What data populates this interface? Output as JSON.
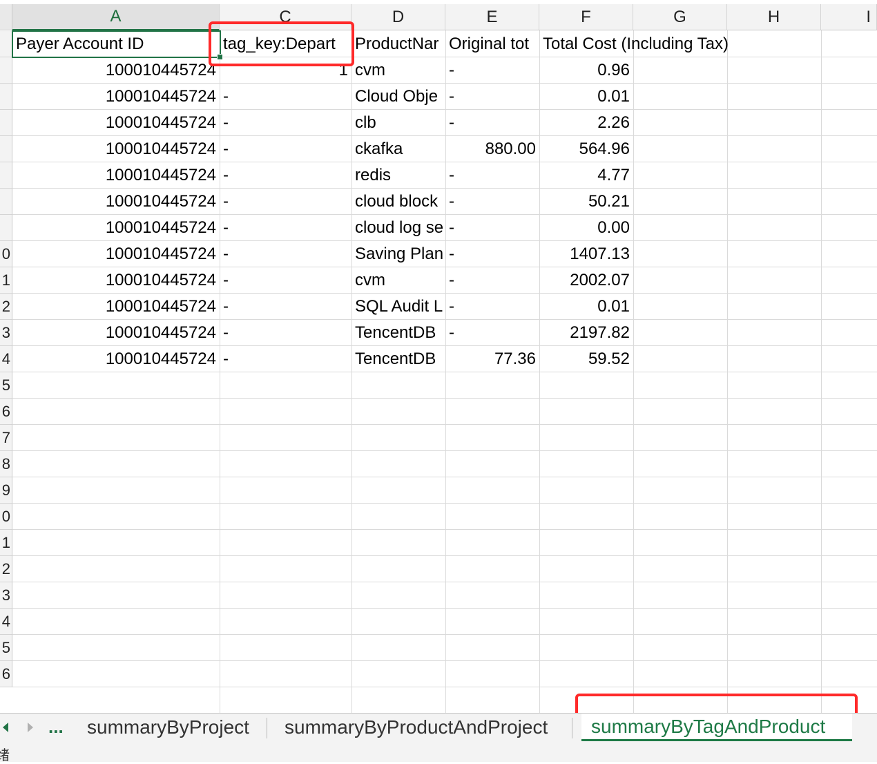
{
  "columns": [
    "A",
    "C",
    "D",
    "E",
    "F",
    "G",
    "H",
    "I"
  ],
  "row_numbers": [
    "",
    "",
    "",
    "",
    "",
    "",
    "",
    "",
    "0",
    "1",
    "2",
    "3",
    "4",
    "5",
    "6",
    "7",
    "8",
    "9",
    "0",
    "1",
    "2",
    "3",
    "4",
    "5",
    "6"
  ],
  "rows": [
    {
      "a": "Payer Account ID",
      "c": "tag_key:Depart",
      "d": "ProductNar",
      "e": "Original tot",
      "f": "Total Cost (Including Tax)"
    },
    {
      "a": "100010445724",
      "c": "1",
      "d": "cvm",
      "e": "-",
      "f": "0.96"
    },
    {
      "a": "100010445724",
      "c": "-",
      "d": "Cloud Obje",
      "e": "-",
      "f": "0.01"
    },
    {
      "a": "100010445724",
      "c": "-",
      "d": "clb",
      "e": "-",
      "f": "2.26"
    },
    {
      "a": "100010445724",
      "c": "-",
      "d": "ckafka",
      "e": "880.00",
      "f": "564.96"
    },
    {
      "a": "100010445724",
      "c": "-",
      "d": "redis",
      "e": "-",
      "f": "4.77"
    },
    {
      "a": "100010445724",
      "c": "-",
      "d": "cloud block",
      "e": "-",
      "f": "50.21"
    },
    {
      "a": "100010445724",
      "c": "-",
      "d": "cloud log se",
      "e": "-",
      "f": "0.00"
    },
    {
      "a": "100010445724",
      "c": "-",
      "d": "Saving Plan",
      "e": "-",
      "f": "1407.13"
    },
    {
      "a": "100010445724",
      "c": "-",
      "d": "cvm",
      "e": "-",
      "f": "2002.07"
    },
    {
      "a": "100010445724",
      "c": "-",
      "d": "SQL Audit L",
      "e": "-",
      "f": "0.01"
    },
    {
      "a": "100010445724",
      "c": "-",
      "d": "TencentDB",
      "e": "-",
      "f": "2197.82"
    },
    {
      "a": "100010445724",
      "c": "-",
      "d": "TencentDB",
      "e": "77.36",
      "f": "59.52"
    }
  ],
  "tabs": {
    "more": "...",
    "items": [
      "summaryByProject",
      "summaryByProductAndProject",
      "summaryByTagAndProduct"
    ],
    "active_index": 2
  },
  "status": {
    "text": "绪"
  },
  "colors": {
    "accent": "#217346",
    "highlight": "#ff2a2a"
  }
}
